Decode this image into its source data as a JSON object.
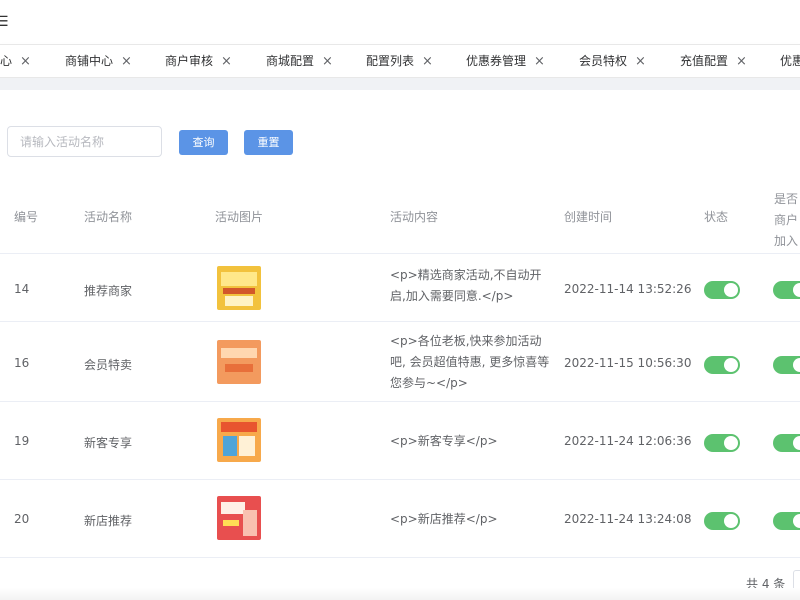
{
  "header": {
    "menu_icon": "hamburger-icon"
  },
  "tabs": [
    {
      "label": "心"
    },
    {
      "label": "商铺中心"
    },
    {
      "label": "商户审核"
    },
    {
      "label": "商城配置"
    },
    {
      "label": "配置列表"
    },
    {
      "label": "优惠券管理"
    },
    {
      "label": "会员特权"
    },
    {
      "label": "充值配置"
    },
    {
      "label": "优惠"
    }
  ],
  "search": {
    "placeholder": "请输入活动名称",
    "query_label": "查询",
    "reset_label": "重置"
  },
  "table": {
    "headers": [
      "编号",
      "活动名称",
      "活动图片",
      "活动内容",
      "创建时间",
      "状态",
      "是否\n商户\n加入"
    ],
    "header_lines": [
      "是否",
      "商户",
      "加入"
    ],
    "rows": [
      {
        "id": "14",
        "name": "推荐商家",
        "content": "<p>精选商家活动,不自动开启,加入需要同意.</p>",
        "time": "2022-11-14 13:52:26",
        "status": true,
        "join": true
      },
      {
        "id": "16",
        "name": "会员特卖",
        "content": "<p>各位老板,快来参加活动吧, 会员超值特惠, 更多惊喜等您参与~</p>",
        "time": "2022-11-15 10:56:30",
        "status": true,
        "join": true
      },
      {
        "id": "19",
        "name": "新客专享",
        "content": "<p>新客专享</p>",
        "time": "2022-11-24 12:06:36",
        "status": true,
        "join": true
      },
      {
        "id": "20",
        "name": "新店推荐",
        "content": "<p>新店推荐</p>",
        "time": "2022-11-24 13:24:08",
        "status": true,
        "join": true
      }
    ]
  },
  "pagination": {
    "total_text": "共 4 条"
  },
  "colors": {
    "primary": "#5b94e6",
    "switch_on": "#5cc26f"
  }
}
